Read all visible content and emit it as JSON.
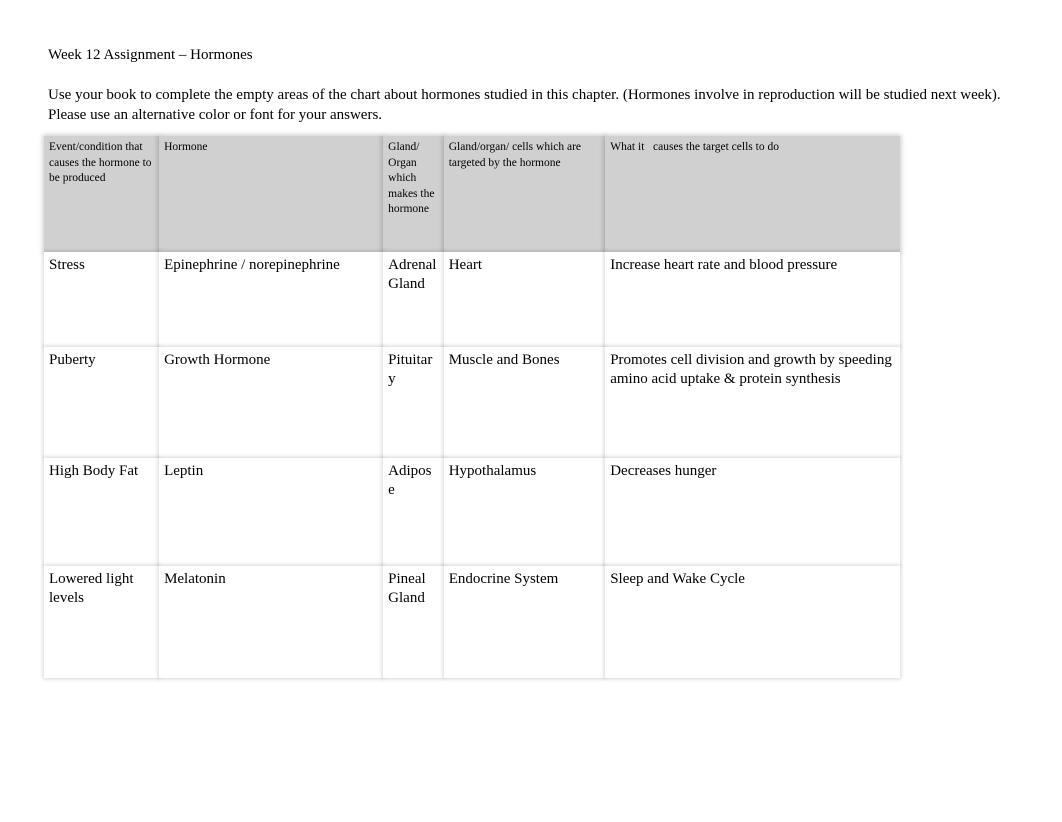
{
  "document": {
    "title": "Week 12 Assignment – Hormones",
    "intro": "Use your book to complete the empty areas of the chart about hormones studied in this chapter.  (Hormones involve in reproduction will be studied next week).  Please use an alternative color or font for your answers."
  },
  "colors": {
    "header_background": "#d0d0d0",
    "cell_background": "#ffffff",
    "page_background": "#ffffff",
    "text": "#000000"
  },
  "chart_data": {
    "type": "table",
    "title": "Week 12 Assignment – Hormones",
    "columns": [
      "Event/condition that causes the hormone to be produced",
      "Hormone",
      "Gland/ Organ which makes the hormone",
      "Gland/organ/ cells which are targeted by the hormone",
      "What it   causes the target cells to do"
    ],
    "rows": [
      {
        "event": "Stress",
        "hormone": "Epinephrine / norepinephrine",
        "gland": "Adrenal Gland",
        "target": "Heart",
        "effect": "Increase heart rate and blood pressure"
      },
      {
        "event": "Puberty",
        "hormone": "Growth Hormone",
        "gland": "Pituitary",
        "target": "Muscle and Bones",
        "effect": "Promotes cell division and growth by speeding amino acid uptake & protein synthesis"
      },
      {
        "event": "High Body Fat",
        "hormone": "Leptin",
        "gland": "Adipose",
        "target": "Hypothalamus",
        "effect": "Decreases hunger"
      },
      {
        "event": "Lowered light levels",
        "hormone": "Melatonin",
        "gland": "Pineal Gland",
        "target": "Endocrine System",
        "effect": "Sleep and Wake Cycle"
      }
    ]
  }
}
